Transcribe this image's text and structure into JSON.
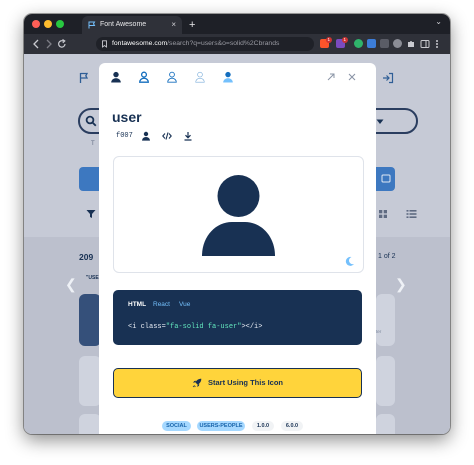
{
  "browser": {
    "tab_title": "Font Awesome",
    "tab_close": "×",
    "new_tab": "+",
    "tab_menu": "⌄",
    "url_host": "fontawesome.com",
    "url_path": "/search?q=users&o=solid%2Cbrands",
    "extension_badges": [
      "1",
      "1"
    ]
  },
  "background": {
    "results_count": "209",
    "results_label_fragment": "\"USE",
    "pagination": "1 of 2",
    "prev_arrow": "❮",
    "next_arrow": "❯",
    "list_snippet": "ter"
  },
  "modal": {
    "style_tabs": [
      "solid",
      "regular",
      "light",
      "thin",
      "duotone"
    ],
    "title": "user",
    "unicode": "f007",
    "code_tabs": [
      "HTML",
      "React",
      "Vue"
    ],
    "active_code_tab": "HTML",
    "code_line": {
      "open": "<i class=",
      "value": "\"fa-solid fa-user\"",
      "close": "></i>"
    },
    "start_button": "Start Using This Icon",
    "categories": [
      "SOCIAL",
      "USERS-PEOPLE"
    ],
    "versions": [
      "1.0.0",
      "6.0.0"
    ]
  },
  "colors": {
    "navy": "#183153",
    "accent_blue": "#146ebe",
    "yellow": "#ffd43b",
    "page_overlay": "#c6cad6",
    "code_green": "#63e6be"
  }
}
